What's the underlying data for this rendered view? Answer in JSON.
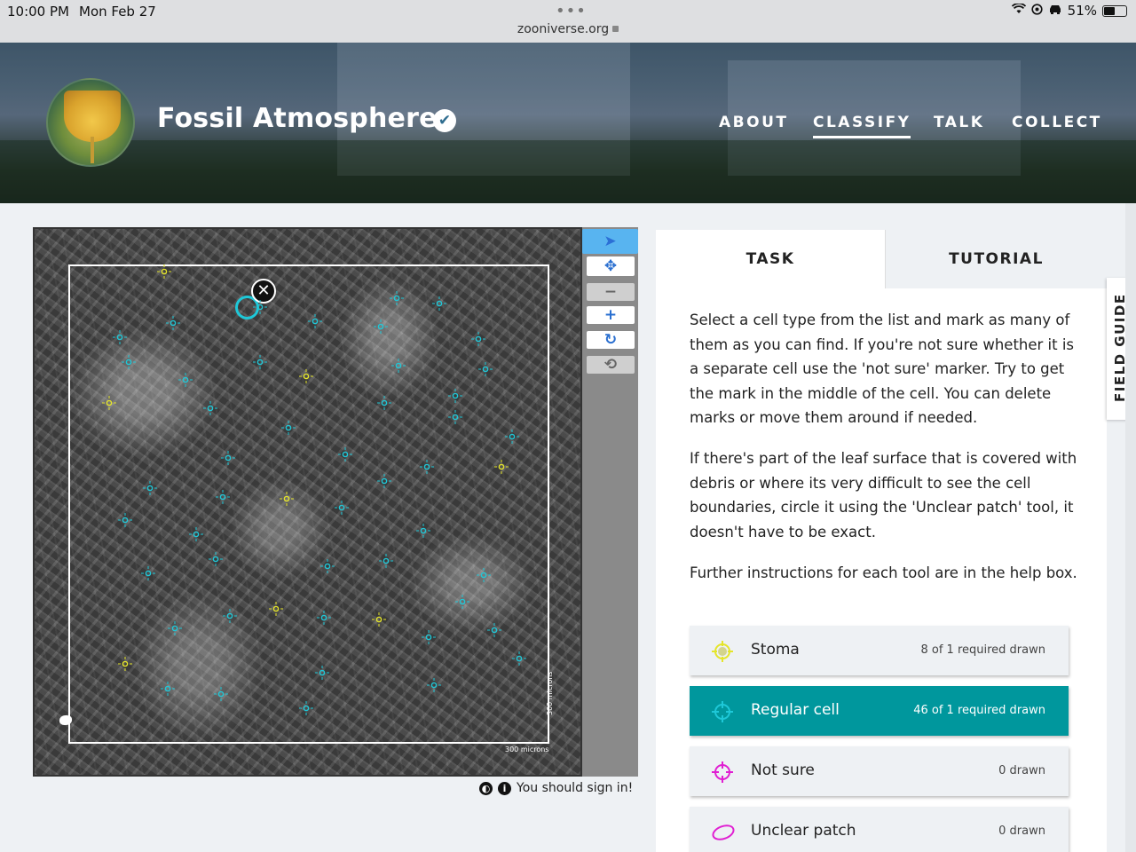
{
  "status_bar": {
    "time": "10:00 PM",
    "date": "Mon Feb 27",
    "dots": "•••",
    "url": "zooniverse.org",
    "battery": "51%",
    "icons": [
      "wifi-icon",
      "location-icon",
      "car-icon",
      "battery-icon"
    ]
  },
  "header": {
    "project_title": "Fossil Atmospheres",
    "verified_mark": "✔",
    "nav": [
      {
        "label": "ABOUT"
      },
      {
        "label": "CLASSIFY",
        "active": true
      },
      {
        "label": "TALK"
      },
      {
        "label": "COLLECT"
      }
    ]
  },
  "subject": {
    "scale_x": "300 microns",
    "scale_y": "300 microns",
    "delete_symbol": "✕"
  },
  "toolbar": {
    "pointer": "➤",
    "move": "✥",
    "zoom_out": "−",
    "zoom_in": "+",
    "rotate": "↻",
    "reset": "⟲"
  },
  "viewer_footer": {
    "invert_icon": "◐",
    "info_icon": "i",
    "sign_in_text": "You should sign in!"
  },
  "panel": {
    "tabs": [
      "TASK",
      "TUTORIAL"
    ],
    "instructions": [
      "Select a cell type from the list and mark as many of them as you can find. If you're not sure whether it is a separate cell use the 'not sure' marker. Try to get the mark in the middle of the cell. You can delete marks or move them around if needed.",
      "If there's part of the leaf surface that is covered with debris or where its very difficult to see the cell boundaries, circle it using the 'Unclear patch' tool, it doesn't have to be exact.",
      "Further instructions for each tool are in the help box."
    ],
    "tools": [
      {
        "name": "Stoma",
        "count": "8 of 1 required drawn",
        "color": "#e5e52a"
      },
      {
        "name": "Regular cell",
        "count": "46 of 1 required drawn",
        "color": "#1ec8d8",
        "active": true
      },
      {
        "name": "Not sure",
        "count": "0 drawn",
        "color": "#e01fd2"
      },
      {
        "name": "Unclear patch",
        "count": "0 drawn",
        "color": "#e01fd2"
      }
    ]
  },
  "field_guide": "FIELD GUIDE",
  "colors": {
    "accent_teal": "#00979d",
    "stoma_yellow": "#e5e52a",
    "cell_cyan": "#1ec8d8",
    "unsure_magenta": "#e01fd2"
  }
}
